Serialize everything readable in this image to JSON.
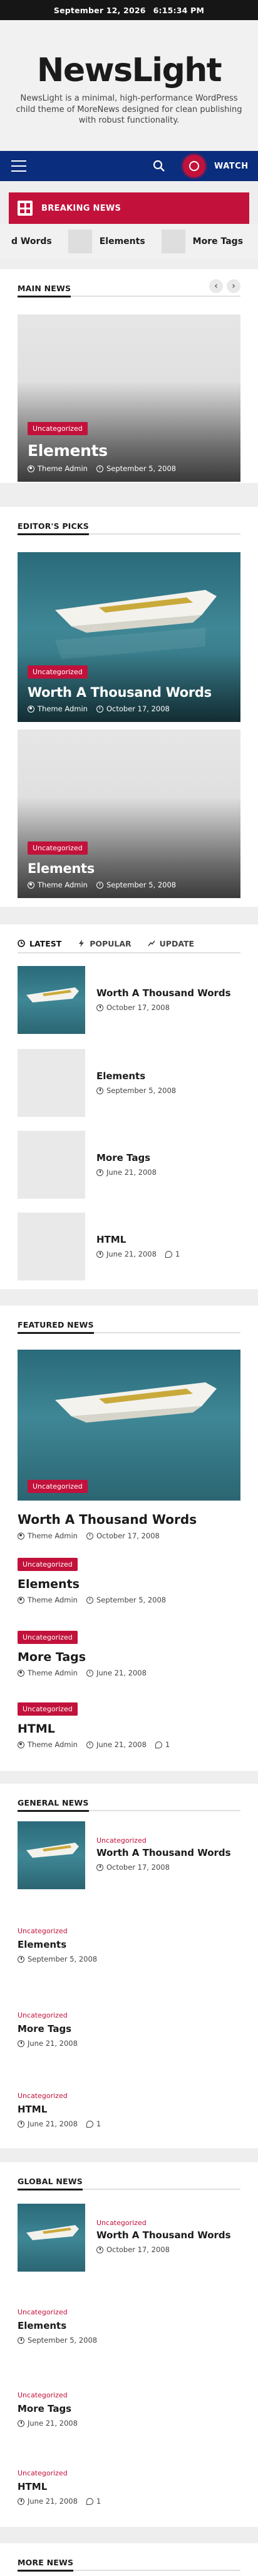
{
  "topbar": {
    "date": "September 12, 2026",
    "time": "6:15:34 PM"
  },
  "site": {
    "title": "NewsLight",
    "tagline": "NewsLight is a minimal, high-performance WordPress child theme of MoreNews designed for clean publishing with robust functionality."
  },
  "nav": {
    "watch_label": "WATCH",
    "menu_icon": "hamburger-icon",
    "search_icon": "search-icon"
  },
  "breaking": {
    "label": "BREAKING NEWS",
    "items": [
      "d Words",
      "Elements",
      "More Tags"
    ]
  },
  "main_news": {
    "title": "MAIN NEWS",
    "prev_label": "‹",
    "next_label": "›",
    "slide": {
      "category": "Uncategorized",
      "title": "Elements",
      "author": "Theme Admin",
      "date": "September 5, 2008"
    }
  },
  "editors_picks": {
    "title": "EDITOR'S PICKS",
    "items": [
      {
        "category": "Uncategorized",
        "title": "Worth A Thousand Words",
        "author": "Theme Admin",
        "date": "October 17, 2008"
      },
      {
        "category": "Uncategorized",
        "title": "Elements",
        "author": "Theme Admin",
        "date": "September 5, 2008"
      }
    ]
  },
  "tabbed": {
    "tabs": [
      "LATEST",
      "POPULAR",
      "UPDATE"
    ],
    "items": [
      {
        "title": "Worth A Thousand Words",
        "date": "October 17, 2008"
      },
      {
        "title": "Elements",
        "date": "September 5, 2008"
      },
      {
        "title": "More Tags",
        "date": "June 21, 2008"
      },
      {
        "title": "HTML",
        "date": "June 21, 2008",
        "comments": "1"
      }
    ]
  },
  "featured": {
    "title": "FEATURED NEWS",
    "items": [
      {
        "category": "Uncategorized",
        "title": "Worth A Thousand Words",
        "author": "Theme Admin",
        "date": "October 17, 2008"
      },
      {
        "category": "Uncategorized",
        "title": "Elements",
        "author": "Theme Admin",
        "date": "September 5, 2008"
      },
      {
        "category": "Uncategorized",
        "title": "More Tags",
        "author": "Theme Admin",
        "date": "June 21, 2008"
      },
      {
        "category": "Uncategorized",
        "title": "HTML",
        "author": "Theme Admin",
        "date": "June 21, 2008",
        "comments": "1"
      }
    ]
  },
  "general": {
    "title": "GENERAL NEWS",
    "items": [
      {
        "category": "Uncategorized",
        "title": "Worth A Thousand Words",
        "date": "October 17, 2008"
      },
      {
        "category": "Uncategorized",
        "title": "Elements",
        "date": "September 5, 2008"
      },
      {
        "category": "Uncategorized",
        "title": "More Tags",
        "date": "June 21, 2008"
      },
      {
        "category": "Uncategorized",
        "title": "HTML",
        "date": "June 21, 2008",
        "comments": "1"
      }
    ]
  },
  "global": {
    "title": "GLOBAL NEWS",
    "items": [
      {
        "category": "Uncategorized",
        "title": "Worth A Thousand Words",
        "date": "October 17, 2008"
      },
      {
        "category": "Uncategorized",
        "title": "Elements",
        "date": "September 5, 2008"
      },
      {
        "category": "Uncategorized",
        "title": "More Tags",
        "date": "June 21, 2008"
      },
      {
        "category": "Uncategorized",
        "title": "HTML",
        "date": "June 21, 2008",
        "comments": "1"
      }
    ]
  },
  "next_section": {
    "title": "MORE NEWS"
  },
  "colors": {
    "accent": "#c2123b",
    "nav": "#0a2d7d",
    "topbar": "#161616"
  }
}
